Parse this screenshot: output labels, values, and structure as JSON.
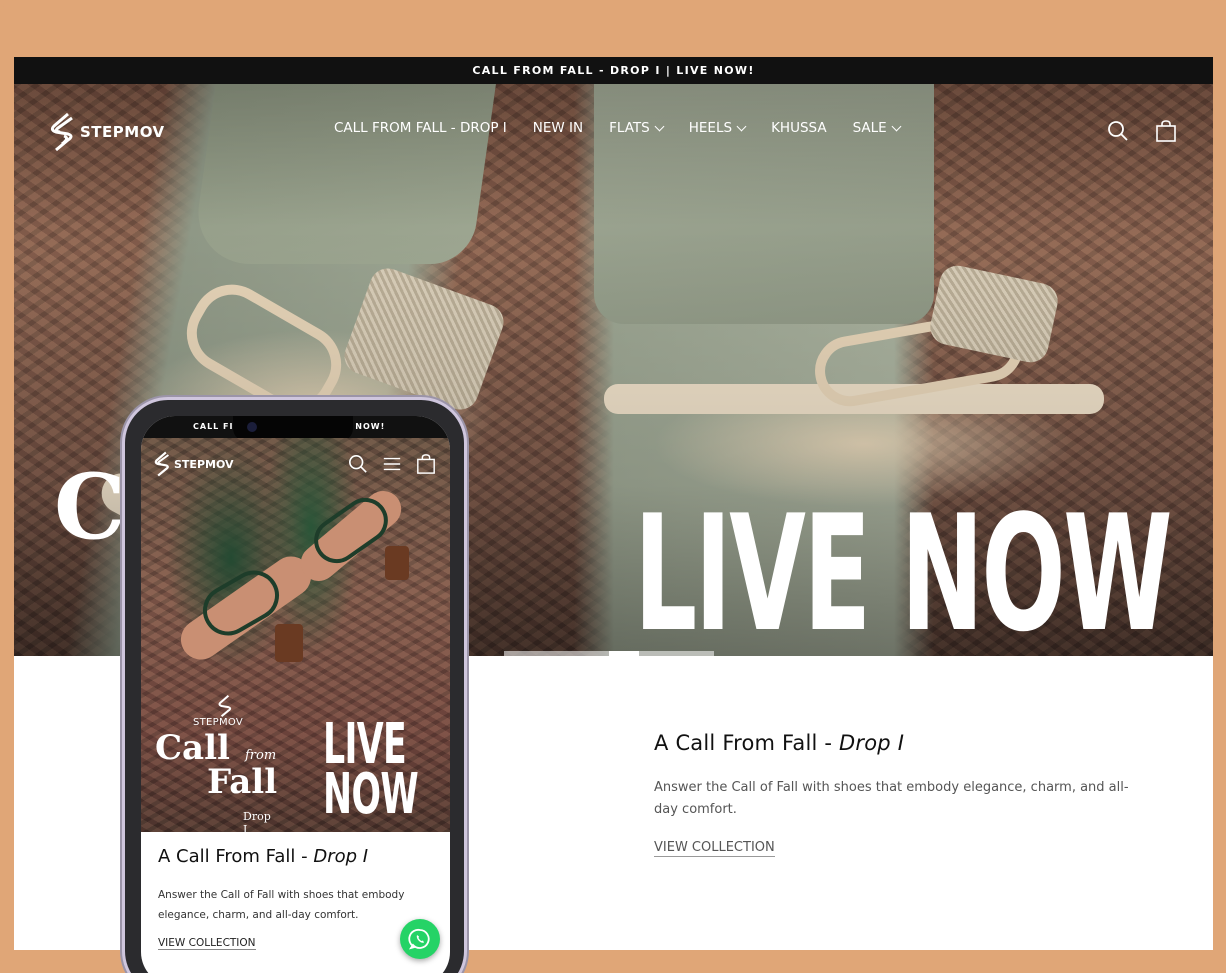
{
  "announcement": "CALL FROM FALL - DROP I | LIVE NOW!",
  "brand": {
    "name": "STEPMOV"
  },
  "nav": {
    "items": [
      {
        "label": "CALL FROM FALL - DROP I",
        "dropdown": false
      },
      {
        "label": "NEW IN",
        "dropdown": false
      },
      {
        "label": "FLATS",
        "dropdown": true
      },
      {
        "label": "HEELS",
        "dropdown": true
      },
      {
        "label": "KHUSSA",
        "dropdown": false
      },
      {
        "label": "SALE",
        "dropdown": true
      }
    ],
    "icons": [
      "search-icon",
      "cart-icon"
    ]
  },
  "hero": {
    "headline": "LIVE NOW",
    "left_text": "Ca",
    "slide_count": 3,
    "active_slide": 2
  },
  "collection": {
    "title": "A Call From Fall - ",
    "title_em": "Drop I",
    "description": "Answer the Call of Fall with shoes that embody elegance, charm, and all-day comfort.",
    "cta": "VIEW COLLECTION"
  },
  "mobile": {
    "announcement_left": "CALL FI",
    "announcement_right": "E NOW!",
    "brand": "STEPMOV",
    "hero_brand": "STEPMOV",
    "hero_call": "Call",
    "hero_from": "from",
    "hero_fall": "Fall",
    "hero_drop": "Drop I",
    "hero_live_1": "LIVE",
    "hero_live_2": "NOW",
    "title": "A Call From Fall - ",
    "title_em": "Drop I",
    "description": "Answer the Call of Fall with shoes that embody elegance, charm, and all-day comfort.",
    "cta": "VIEW COLLECTION",
    "icons": [
      "search-icon",
      "menu-icon",
      "cart-icon",
      "whatsapp-icon"
    ]
  },
  "colors": {
    "background": "#e0a677",
    "announcement_bar": "#111111",
    "whatsapp": "#25d366"
  }
}
